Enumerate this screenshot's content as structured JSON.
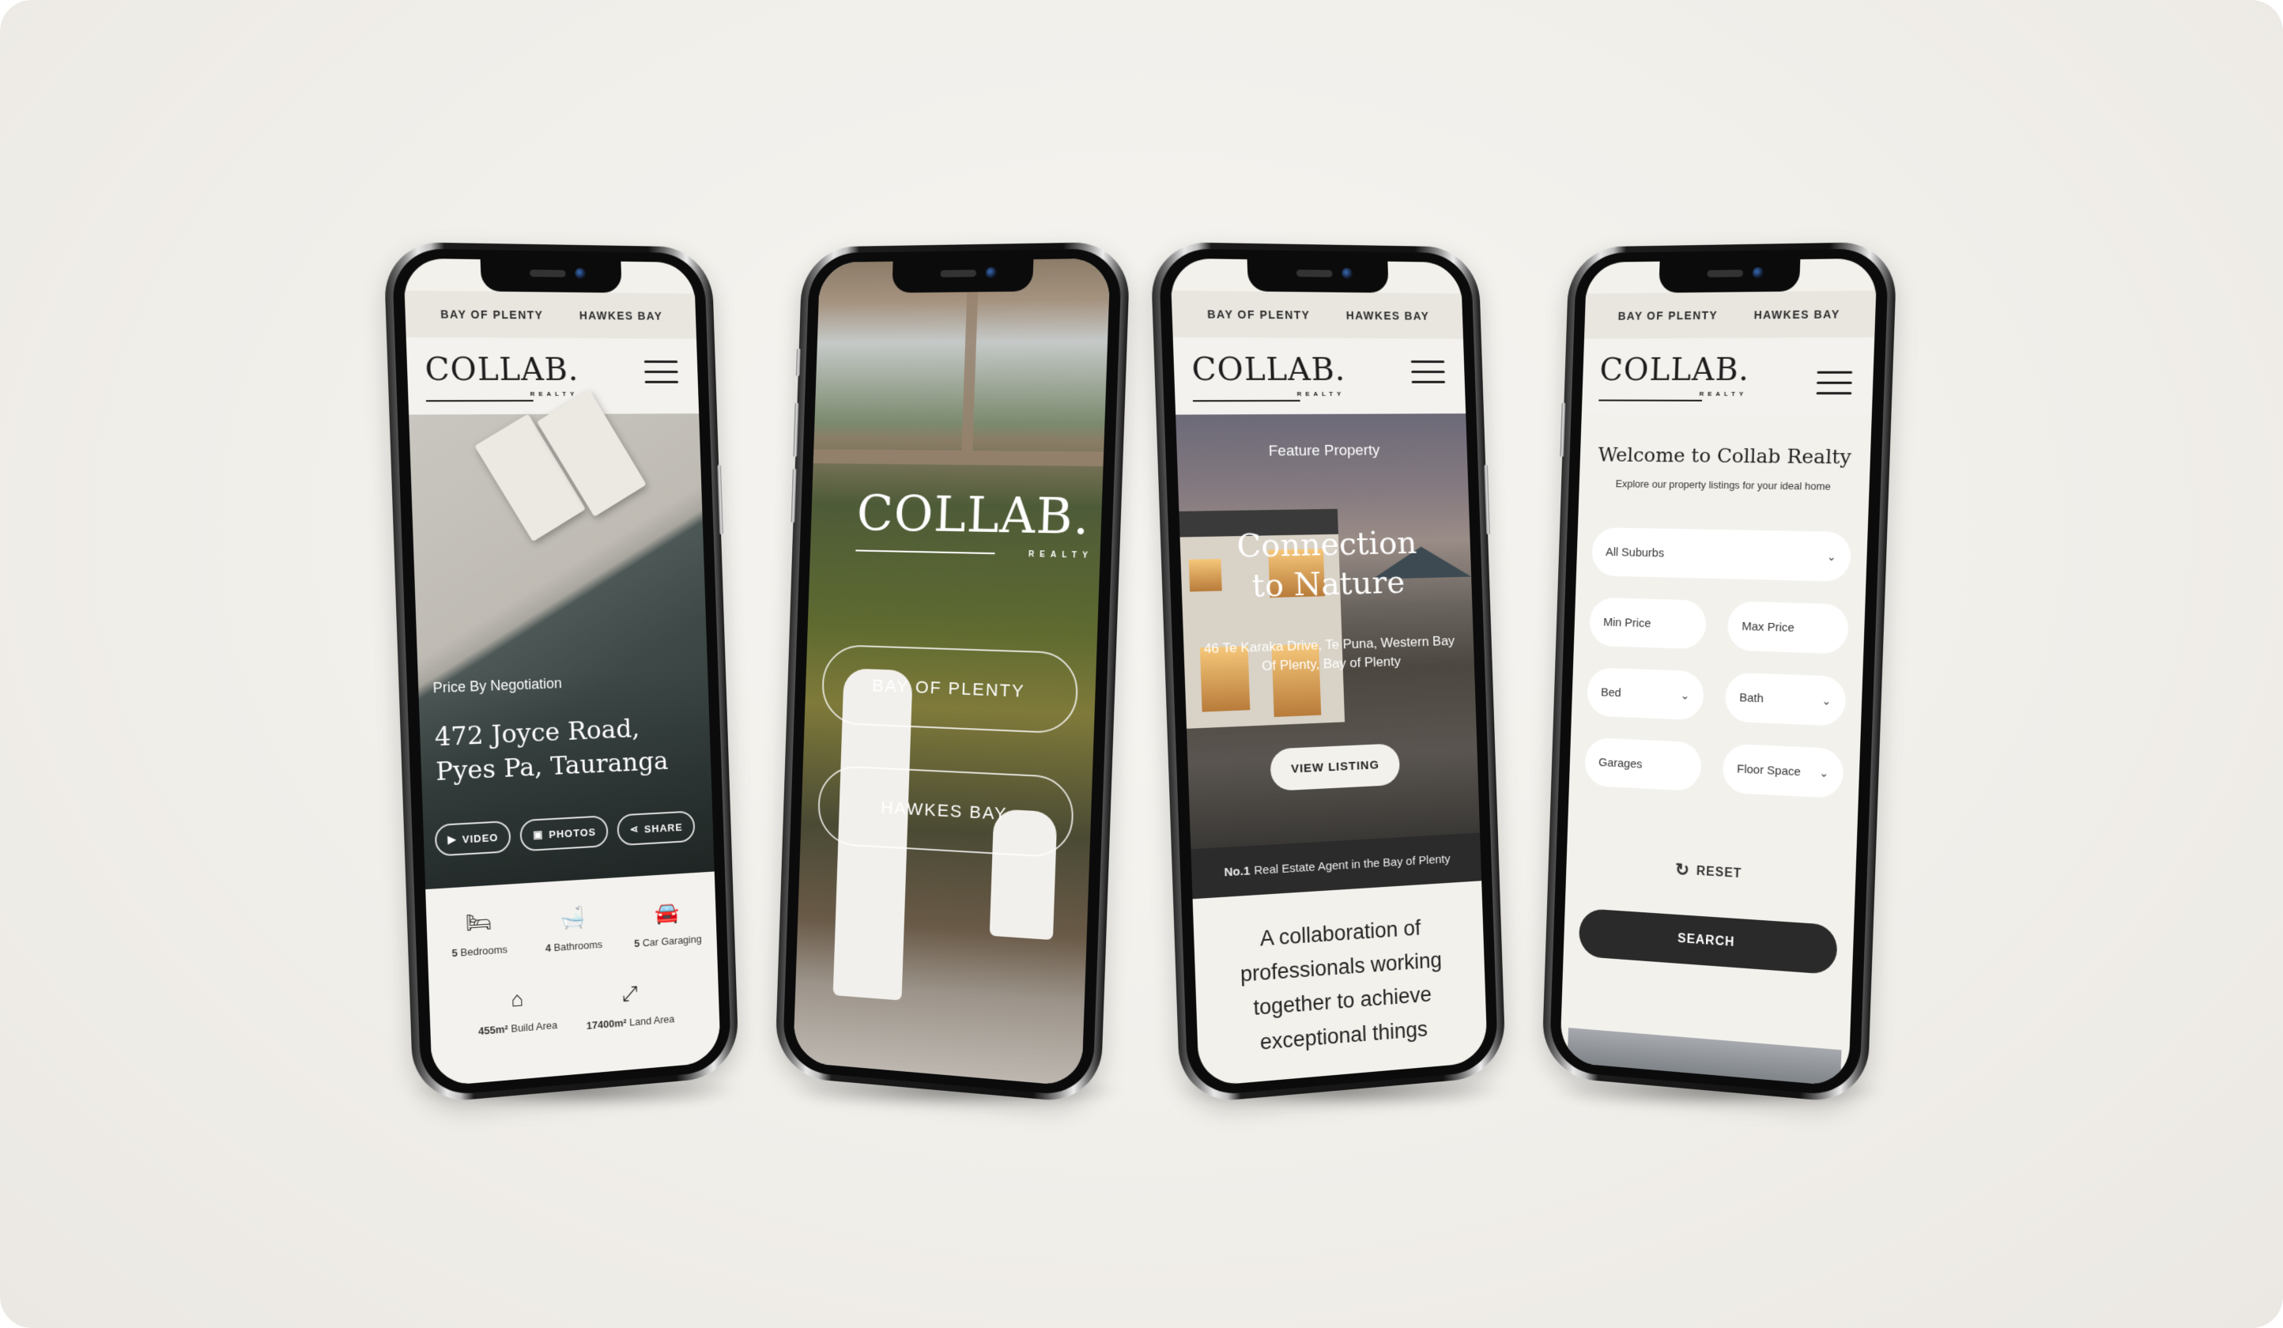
{
  "brand": {
    "logo_word": "COLLAB.",
    "logo_sub": "REALTY"
  },
  "nav": {
    "region_1": "BAY OF PLENTY",
    "region_2": "HAWKES BAY",
    "menu_icon": "hamburger-icon"
  },
  "phone1": {
    "price": "Price By Negotiation",
    "address_line1": "472 Joyce Road,",
    "address_line2": "Pyes Pa, Tauranga",
    "actions": [
      {
        "label": "VIDEO",
        "icon": "play-icon"
      },
      {
        "label": "PHOTOS",
        "icon": "photos-icon"
      },
      {
        "label": "SHARE",
        "icon": "share-icon"
      }
    ],
    "stats": [
      {
        "value": "5",
        "label": "Bedrooms",
        "icon": "bed-icon"
      },
      {
        "value": "4",
        "label": "Bathrooms",
        "icon": "bathtub-icon"
      },
      {
        "value": "5",
        "label": "Car Garaging",
        "icon": "garage-icon"
      },
      {
        "value": "455m²",
        "label": "Build Area",
        "icon": "house-icon"
      },
      {
        "value": "17400m²",
        "label": "Land Area",
        "icon": "land-area-icon"
      }
    ]
  },
  "phone2": {
    "buttons": [
      "BAY OF PLENTY",
      "HAWKES BAY"
    ]
  },
  "phone3": {
    "feature_label": "Feature Property",
    "title_line1": "Connection",
    "title_line2": "to Nature",
    "address": "46 Te Karaka Drive, Te Puna, Western Bay Of Plenty, Bay of Plenty",
    "cta": "VIEW LISTING",
    "strip_bold": "No.1",
    "strip_text": "Real Estate Agent in the Bay of Plenty",
    "tagline": "A collaboration of professionals working together to achieve exceptional things"
  },
  "phone4": {
    "welcome": "Welcome to Collab Realty",
    "subtitle": "Explore our property listings for your ideal home",
    "suburbs": "All Suburbs",
    "min_price": "Min Price",
    "max_price": "Max Price",
    "bed": "Bed",
    "bath": "Bath",
    "garages": "Garages",
    "floor_space": "Floor Space",
    "reset": "RESET",
    "search": "SEARCH"
  }
}
